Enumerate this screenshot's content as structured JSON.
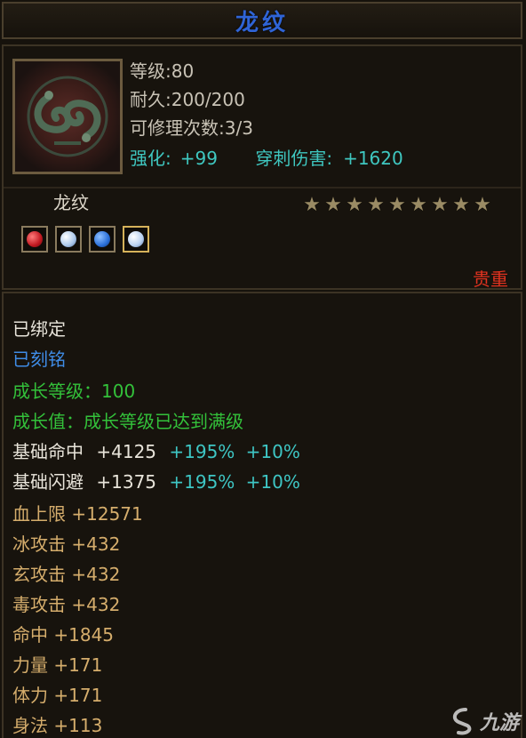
{
  "title": "龙纹",
  "stats": {
    "level": "等级:80",
    "durability": "耐久:200/200",
    "repair": "可修理次数:3/3",
    "enhance_label": "强化:",
    "enhance_value": "+99",
    "pierce_label": "穿刺伤害:",
    "pierce_value": "+1620"
  },
  "item_name": "龙纹",
  "stars": [
    "★",
    "★",
    "★",
    "★",
    "★",
    "★",
    "★",
    "★",
    "★"
  ],
  "gems": [
    {
      "name": "red-gem-icon",
      "color": "#d0202a"
    },
    {
      "name": "white-gem-icon",
      "color": "#b8d4f0"
    },
    {
      "name": "blue-gem-icon",
      "color": "#2a6fd8"
    },
    {
      "name": "white-gem-icon-active",
      "color": "#c8dcf4"
    }
  ],
  "quality": "贵重",
  "details": {
    "bound": "已绑定",
    "engraved": "已刻铭",
    "growth_level": "成长等级：100",
    "growth_value": "成长值：成长等级已达到满级",
    "base_hit_label": "基础命中",
    "base_hit_value": "+4125",
    "base_hit_p1": "+195%",
    "base_hit_p2": "+10%",
    "base_dodge_label": "基础闪避",
    "base_dodge_value": "+1375",
    "base_dodge_p1": "+195%",
    "base_dodge_p2": "+10%",
    "hp": "血上限  +12571",
    "ice": "冰攻击  +432",
    "dark": "玄攻击  +432",
    "poison": "毒攻击  +432",
    "hit": "命中  +1845",
    "str": "力量  +171",
    "vit": "体力  +171",
    "agi": "身法  +113"
  },
  "watermark": "九游"
}
